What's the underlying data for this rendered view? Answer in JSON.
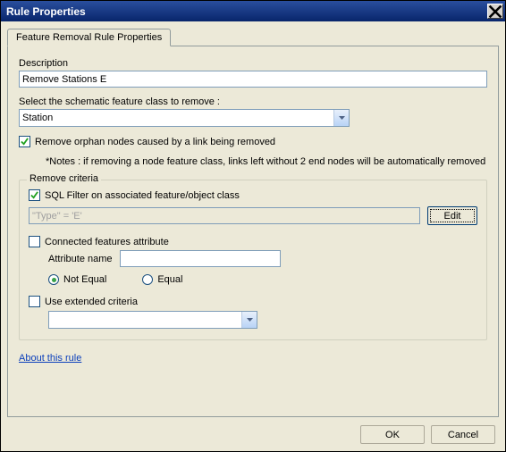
{
  "window": {
    "title": "Rule Properties"
  },
  "tab": {
    "label": "Feature Removal Rule Properties"
  },
  "description": {
    "label": "Description",
    "value": "Remove Stations E"
  },
  "feature_class": {
    "label": "Select the schematic feature class to remove :",
    "value": "Station"
  },
  "remove_orphan": {
    "checked": true,
    "label": "Remove orphan nodes caused by a link being removed"
  },
  "notes": "*Notes : if removing a node feature class, links left without 2 end nodes will be automatically removed",
  "criteria": {
    "legend": "Remove criteria",
    "sql": {
      "checked": true,
      "label": "SQL Filter on associated feature/object class",
      "value": "\"Type\" = 'E'",
      "edit": "Edit"
    },
    "connected": {
      "checked": false,
      "label": "Connected features attribute",
      "attr_label": "Attribute name",
      "attr_value": "",
      "not_equal": "Not Equal",
      "equal": "Equal",
      "selected": "not_equal"
    },
    "extended": {
      "checked": false,
      "label": "Use extended criteria",
      "value": ""
    }
  },
  "link": "About this rule",
  "buttons": {
    "ok": "OK",
    "cancel": "Cancel"
  }
}
